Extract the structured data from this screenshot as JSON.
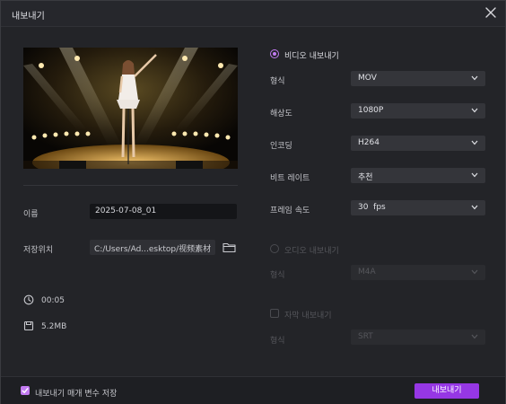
{
  "dialog": {
    "title": "내보내기"
  },
  "left": {
    "name_label": "이름",
    "name_value": "2025-07-08_01",
    "location_label": "저장위치",
    "location_value": "C:/Users/Ad...esktop/视频素材",
    "duration": "00:05",
    "size": "5.2MB"
  },
  "video": {
    "section_label": "비디오 내보내기",
    "rows": [
      {
        "label": "형식",
        "value": "MOV"
      },
      {
        "label": "해상도",
        "value": "1080P"
      },
      {
        "label": "인코딩",
        "value": "H264"
      },
      {
        "label": "비트 레이트",
        "value": "추천"
      },
      {
        "label": "프레임 속도",
        "value": "30  fps"
      }
    ]
  },
  "audio": {
    "section_label": "오디오 내보내기",
    "format_label": "형식",
    "format_value": "M4A"
  },
  "subtitle": {
    "section_label": "자막 내보내기",
    "format_label": "형식",
    "format_value": "SRT"
  },
  "footer": {
    "remember_label": "내보내기 매개 변수 저장",
    "export_button": "내보내기"
  },
  "colors": {
    "accent": "#9637e4",
    "radio": "#c27bf1"
  }
}
